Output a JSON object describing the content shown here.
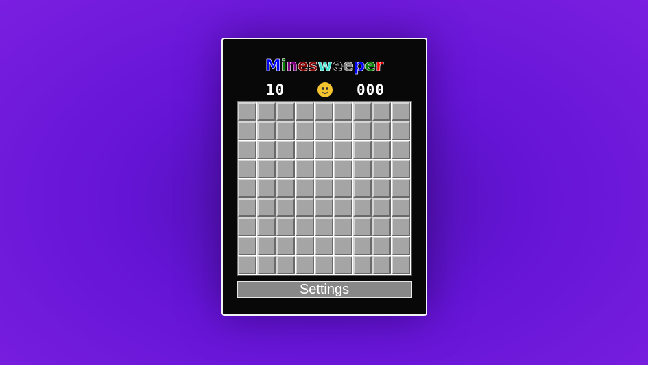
{
  "title": {
    "letters": [
      "M",
      "i",
      "n",
      "e",
      "s",
      "w",
      "e",
      "e",
      "p",
      "e",
      "r"
    ],
    "colors": [
      "#0000ff",
      "#008000",
      "#800080",
      "#800000",
      "#8b0000",
      "#40e0d0",
      "#000000",
      "#808080",
      "#0000ff",
      "#008000",
      "#ff0000"
    ]
  },
  "header": {
    "mines_remaining": "10",
    "timer": "000",
    "face_icon": "smiley-face-icon"
  },
  "board": {
    "rows": 9,
    "cols": 9,
    "cell_state": "covered"
  },
  "settings_label": "Settings"
}
